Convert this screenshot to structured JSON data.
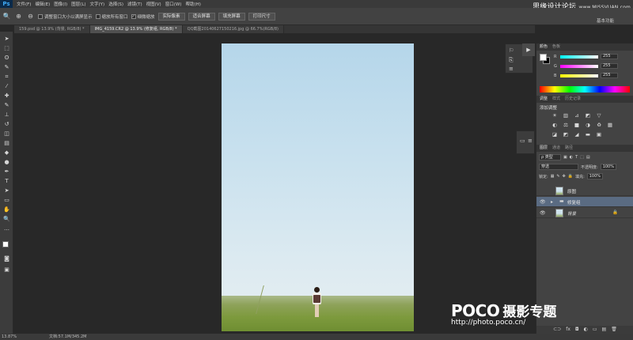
{
  "app": {
    "logo": "Ps",
    "menu": [
      "文件(F)",
      "编辑(E)",
      "图像(I)",
      "图层(L)",
      "文字(Y)",
      "选择(S)",
      "滤镜(T)",
      "视图(V)",
      "窗口(W)",
      "帮助(H)"
    ],
    "watermark_top": "思缘设计论坛",
    "watermark_top_url": "www.MISSVUAN.com",
    "workspace": "基本功能"
  },
  "options_bar": {
    "resize_windows": "调整窗口大小以满屏显示",
    "zoom_all": "缩放所有窗口",
    "scrubby_zoom": "细微缩放",
    "actual_pixels": "实际像素",
    "fit_screen": "适合屏幕",
    "fill_screen": "填充屏幕",
    "print_size": "打印尺寸"
  },
  "tabs": [
    {
      "label": "159.psd @ 13.9% (背景, RGB/8) *",
      "active": false
    },
    {
      "label": "IMG_4159.CR2 @ 13.9% (修复组, RGB/8) *",
      "active": true
    },
    {
      "label": "QQ截图20140627150216.jpg @ 66.7%(RGB/8)",
      "active": false
    }
  ],
  "color_panel": {
    "tabs": [
      "颜色",
      "色板"
    ],
    "sliders": [
      {
        "label": "R",
        "value": "255",
        "gradient": "linear-gradient(90deg,#00ffff,#ffffff)"
      },
      {
        "label": "G",
        "value": "255",
        "gradient": "linear-gradient(90deg,#ff00ff,#ffffff)"
      },
      {
        "label": "B",
        "value": "255",
        "gradient": "linear-gradient(90deg,#ffff00,#ffffff)"
      }
    ]
  },
  "adjustments_panel": {
    "tabs": [
      "调整",
      "样式",
      "历史记录"
    ],
    "title": "添加调整",
    "icons": [
      "☀",
      "▥",
      "⊿",
      "◩",
      "▽",
      "",
      "◐",
      "⚖",
      "■",
      "◑",
      "♻",
      "▦",
      "◪",
      "◩",
      "◢",
      "▬",
      "▣",
      ""
    ]
  },
  "layers_panel": {
    "tabs": [
      "图层",
      "通道",
      "路径"
    ],
    "kind": "ρ 类型",
    "blend_mode": "穿透",
    "opacity_label": "不透明度:",
    "opacity": "100%",
    "lock_label": "锁定:",
    "fill_label": "填充:",
    "fill": "100%",
    "layers": [
      {
        "name": "原图",
        "visible": false,
        "type": "image",
        "selected": false,
        "locked": false
      },
      {
        "name": "修复组",
        "visible": true,
        "type": "group",
        "selected": true,
        "locked": false
      },
      {
        "name": "背景",
        "visible": true,
        "type": "image",
        "selected": false,
        "locked": true
      }
    ],
    "footer": [
      "⊂⊃",
      "fx",
      "◘",
      "◐",
      "▭",
      "▤",
      "🗑"
    ]
  },
  "status": {
    "zoom": "13.87%",
    "doc": "文档:57.1M/345.2M"
  },
  "watermark_bottom": {
    "brand": "POCO",
    "brand_cn": "摄影专题",
    "url": "http://photo.poco.cn/"
  }
}
